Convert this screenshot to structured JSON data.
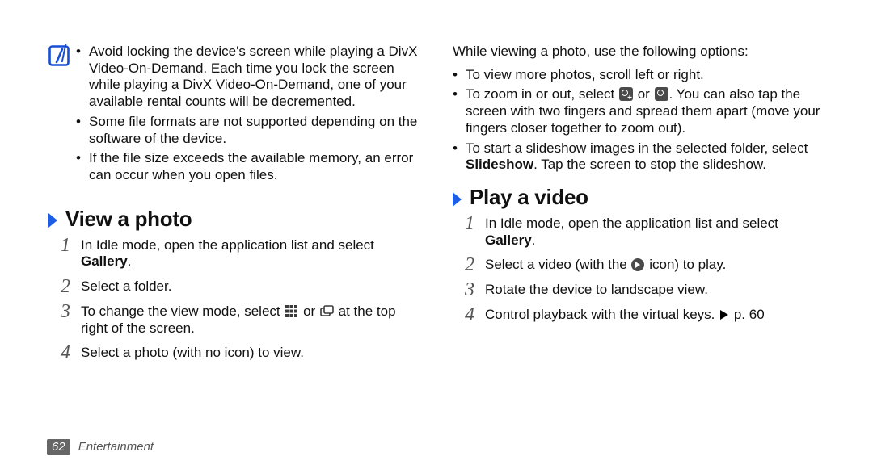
{
  "footer": {
    "page_num": "62",
    "section": "Entertainment"
  },
  "left": {
    "callout": {
      "bullets": [
        "Avoid locking the device's screen while playing a DivX Video-On-Demand. Each time you lock the screen while playing a DivX Video-On-Demand, one of your available rental counts will be decremented.",
        "Some file formats are not supported depending on the software of the device.",
        "If the file size exceeds the available memory, an error can occur when you open files."
      ]
    },
    "section_a": {
      "title": "View a photo",
      "steps": {
        "s1_a": "In Idle mode, open the application list and select ",
        "s1_b": "Gallery",
        "s1_c": ".",
        "s2": "Select a folder.",
        "s3_a": "To change the view mode, select ",
        "s3_b": " or ",
        "s3_c": " at the top right of the screen.",
        "s4": "Select a photo (with no icon) to view."
      }
    }
  },
  "right": {
    "intro": "While viewing a photo, use the following options:",
    "opt1": "To view more photos, scroll left or right.",
    "opt2_a": "To zoom in or out, select ",
    "opt2_b": " or ",
    "opt2_c": ". You can also tap the screen with two fingers and spread them apart (move your fingers closer together to zoom out).",
    "opt3_a": "To start a slideshow images in the selected folder, select ",
    "opt3_b": "Slideshow",
    "opt3_c": ". Tap the screen to stop the slideshow.",
    "section_b": {
      "title": "Play a video",
      "s1_a": "In Idle mode, open the application list and select ",
      "s1_b": "Gallery",
      "s1_c": ".",
      "s2_a": "Select a video (with the ",
      "s2_b": " icon) to play.",
      "s3": "Rotate the device to landscape view.",
      "s4_a": "Control playback with the virtual keys. ",
      "s4_b": " p. 60"
    }
  }
}
